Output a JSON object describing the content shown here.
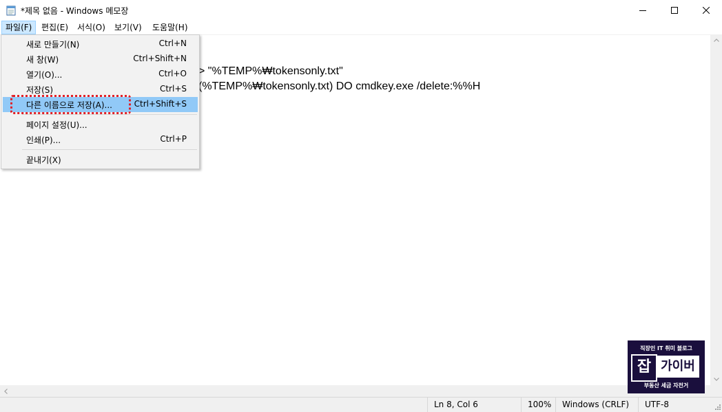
{
  "window": {
    "title": "*제목 없음 - Windows 메모장",
    "icon": "notepad-icon"
  },
  "controls": {
    "minimize_icon": "minimize-icon",
    "maximize_icon": "maximize-icon",
    "close_icon": "close-icon"
  },
  "menubar": {
    "items": [
      {
        "label": "파일(F)",
        "active": true
      },
      {
        "label": "편집(E)"
      },
      {
        "label": "서식(O)"
      },
      {
        "label": "보기(V)"
      },
      {
        "label": "도움말(H)"
      }
    ]
  },
  "file_menu": {
    "items": [
      {
        "label": "새로 만들기(N)",
        "shortcut": "Ctrl+N"
      },
      {
        "label": "새 창(W)",
        "shortcut": "Ctrl+Shift+N"
      },
      {
        "label": "열기(O)...",
        "shortcut": "Ctrl+O"
      },
      {
        "label": "저장(S)",
        "shortcut": "Ctrl+S"
      },
      {
        "label": "다른 이름으로 저장(A)...",
        "shortcut": "Ctrl+Shift+S",
        "highlighted": true
      },
      {
        "label": "페이지 설정(U)...",
        "shortcut": ""
      },
      {
        "label": "인쇄(P)...",
        "shortcut": "Ctrl+P"
      },
      {
        "label": "끝내기(X)",
        "shortcut": ""
      }
    ]
  },
  "editor": {
    "visible_lines": [
      "> \"%TEMP%₩tokensonly.txt\"",
      "(%TEMP%₩tokensonly.txt) DO cmdkey.exe /delete:%%H"
    ]
  },
  "statusbar": {
    "position": "Ln 8, Col 6",
    "zoom": "100%",
    "line_ending": "Windows (CRLF)",
    "encoding": "UTF-8"
  },
  "watermark": {
    "top_text": "직장인 IT 취미 블로그",
    "left_char": "잡",
    "right_text": "가이버",
    "bottom_text": "부동산 세금 자전거"
  },
  "colors": {
    "menu_highlight": "#91c9f7",
    "menubar_active": "#cce8ff",
    "annotation": "#e21f26",
    "logo_bg": "#1a0f3d"
  }
}
